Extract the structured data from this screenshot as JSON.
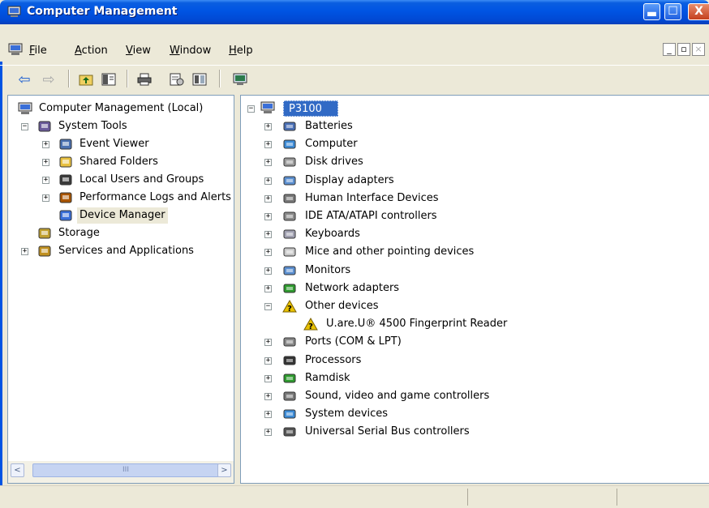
{
  "window": {
    "title": "Computer Management",
    "controls": {
      "minimize": "_",
      "maximize": "□",
      "close": "X"
    }
  },
  "menubar": {
    "items": [
      {
        "label": "File",
        "accel": "F",
        "rest": "ile"
      },
      {
        "label": "Action",
        "accel": "A",
        "rest": "ction"
      },
      {
        "label": "View",
        "accel": "V",
        "rest": "iew"
      },
      {
        "label": "Window",
        "accel": "W",
        "rest": "indow"
      },
      {
        "label": "Help",
        "accel": "H",
        "rest": "elp"
      }
    ],
    "mdi_controls": [
      "_",
      "0",
      "x"
    ]
  },
  "toolbar": {
    "buttons": [
      {
        "name": "back-icon",
        "glyph": "⇦"
      },
      {
        "name": "forward-icon",
        "glyph": "⇨"
      },
      {
        "name": "up-folder-icon",
        "glyph": ""
      },
      {
        "name": "show-hide-tree-icon",
        "glyph": ""
      },
      {
        "name": "print-icon",
        "glyph": ""
      },
      {
        "name": "properties-icon",
        "glyph": ""
      },
      {
        "name": "help-icon",
        "glyph": ""
      },
      {
        "name": "scan-hardware-icon",
        "glyph": ""
      }
    ]
  },
  "left_tree": {
    "root": "Computer Management (Local)",
    "items": [
      {
        "label": "System Tools",
        "level": 1,
        "expander": "−",
        "icon": "system-tools-icon"
      },
      {
        "label": "Event Viewer",
        "level": 2,
        "expander": "+",
        "icon": "event-viewer-icon"
      },
      {
        "label": "Shared Folders",
        "level": 2,
        "expander": "+",
        "icon": "shared-folders-icon"
      },
      {
        "label": "Local Users and Groups",
        "level": 2,
        "expander": "+",
        "icon": "users-icon"
      },
      {
        "label": "Performance Logs and Alerts",
        "level": 2,
        "expander": "+",
        "icon": "performance-icon"
      },
      {
        "label": "Device Manager",
        "level": 2,
        "expander": "",
        "icon": "device-manager-icon",
        "selected": true
      },
      {
        "label": "Storage",
        "level": 1,
        "expander": "",
        "icon": "storage-icon"
      },
      {
        "label": "Services and Applications",
        "level": 1,
        "expander": "+",
        "icon": "services-icon"
      }
    ]
  },
  "device_tree": {
    "root": "P3100",
    "items": [
      {
        "label": "Batteries",
        "expander": "+",
        "icon": "battery-icon",
        "color": "#4a6fb5"
      },
      {
        "label": "Computer",
        "expander": "+",
        "icon": "computer-icon",
        "color": "#3d8bd6"
      },
      {
        "label": "Disk drives",
        "expander": "+",
        "icon": "disk-icon",
        "color": "#9a9a9a"
      },
      {
        "label": "Display adapters",
        "expander": "+",
        "icon": "display-icon",
        "color": "#5b8fd0"
      },
      {
        "label": "Human Interface Devices",
        "expander": "+",
        "icon": "hid-icon",
        "color": "#7a7a7a"
      },
      {
        "label": "IDE ATA/ATAPI controllers",
        "expander": "+",
        "icon": "ide-icon",
        "color": "#8a8a8a"
      },
      {
        "label": "Keyboards",
        "expander": "+",
        "icon": "keyboard-icon",
        "color": "#a0a0b0"
      },
      {
        "label": "Mice and other pointing devices",
        "expander": "+",
        "icon": "mouse-icon",
        "color": "#c8c8c8"
      },
      {
        "label": "Monitors",
        "expander": "+",
        "icon": "monitor-icon",
        "color": "#5b8fd0"
      },
      {
        "label": "Network adapters",
        "expander": "+",
        "icon": "network-icon",
        "color": "#2e9b2e"
      },
      {
        "label": "Other devices",
        "expander": "−",
        "icon": "unknown-device-icon",
        "color": "#e8c100"
      },
      {
        "label": "U.are.U® 4500 Fingerprint Reader",
        "expander": "",
        "icon": "warning-device-icon",
        "color": "#e8c100",
        "child": true
      },
      {
        "label": "Ports (COM & LPT)",
        "expander": "+",
        "icon": "port-icon",
        "color": "#888888"
      },
      {
        "label": "Processors",
        "expander": "+",
        "icon": "processor-icon",
        "color": "#333333"
      },
      {
        "label": "Ramdisk",
        "expander": "+",
        "icon": "ramdisk-icon",
        "color": "#2e9b2e"
      },
      {
        "label": "Sound, video and game controllers",
        "expander": "+",
        "icon": "sound-icon",
        "color": "#777777"
      },
      {
        "label": "System devices",
        "expander": "+",
        "icon": "system-devices-icon",
        "color": "#3d8bd6"
      },
      {
        "label": "Universal Serial Bus controllers",
        "expander": "+",
        "icon": "usb-icon",
        "color": "#555555"
      }
    ]
  },
  "scrollbar": {
    "left": "<",
    "right": ">",
    "thumb": "III"
  },
  "colors": {
    "title_blue": "#0054e3",
    "selection_blue": "#316ac5",
    "window_bg": "#ece9d8"
  }
}
